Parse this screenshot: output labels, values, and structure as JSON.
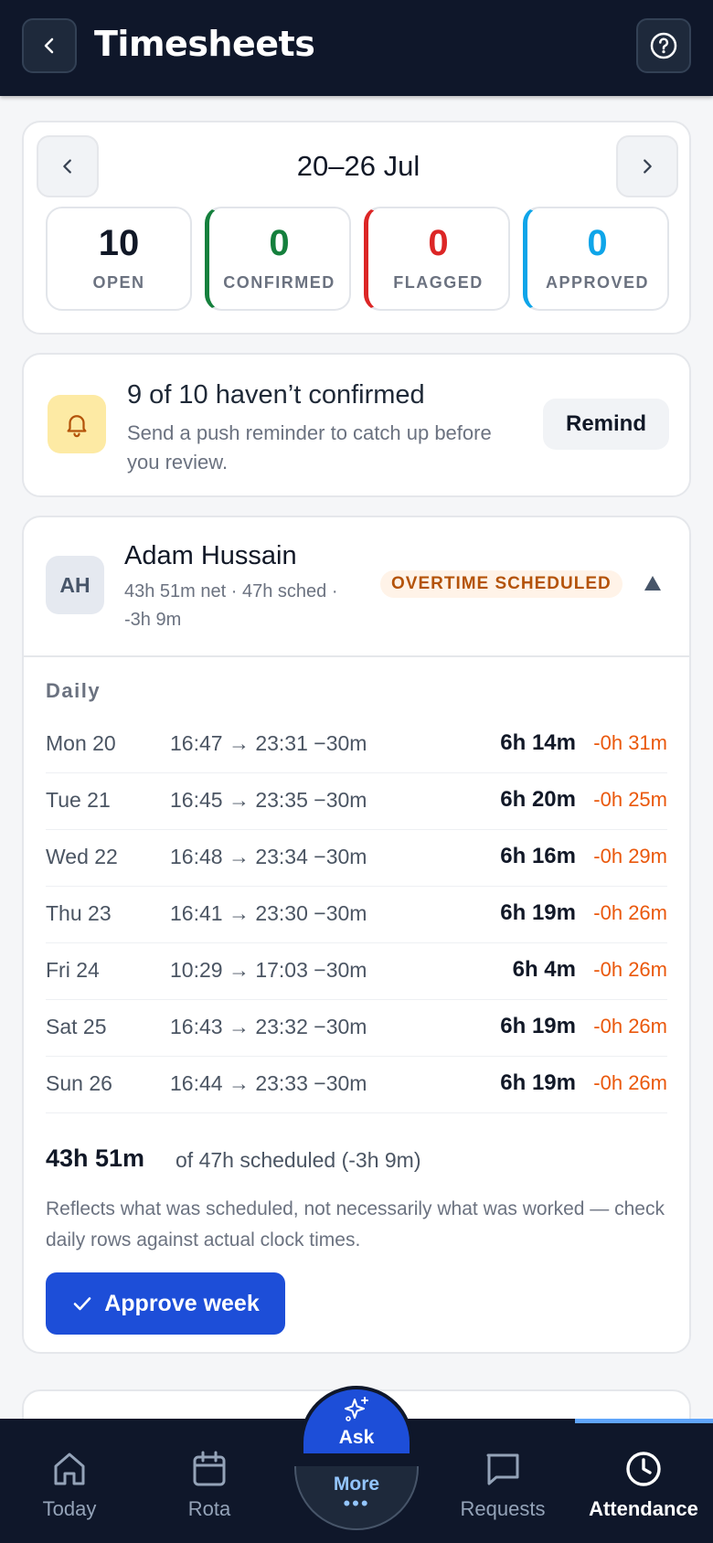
{
  "header": {
    "title": "Timesheets"
  },
  "week": {
    "label": "20–26 Jul",
    "stats": [
      {
        "value": "10",
        "label": "OPEN"
      },
      {
        "value": "0",
        "label": "CONFIRMED"
      },
      {
        "value": "0",
        "label": "FLAGGED"
      },
      {
        "value": "0",
        "label": "APPROVED"
      }
    ]
  },
  "reminder": {
    "title": "9 of 10 haven’t confirmed",
    "subtitle": "Send a push reminder to catch up before you review.",
    "button": "Remind"
  },
  "employee": {
    "initials": "AH",
    "name": "Adam Hussain",
    "summary": "43h 51m net · 47h sched · -3h 9m",
    "badge": "OVERTIME SCHEDULED",
    "daily_label": "Daily",
    "days": [
      {
        "day": "Mon 20",
        "times": "16:47 → 23:31 −30m",
        "hours": "6h 14m",
        "variance": "-0h 31m"
      },
      {
        "day": "Tue 21",
        "times": "16:45 → 23:35 −30m",
        "hours": "6h 20m",
        "variance": "-0h 25m"
      },
      {
        "day": "Wed 22",
        "times": "16:48 → 23:34 −30m",
        "hours": "6h 16m",
        "variance": "-0h 29m"
      },
      {
        "day": "Thu 23",
        "times": "16:41 → 23:30 −30m",
        "hours": "6h 19m",
        "variance": "-0h 26m"
      },
      {
        "day": "Fri 24",
        "times": "10:29 → 17:03 −30m",
        "hours": "6h 4m",
        "variance": "-0h 26m"
      },
      {
        "day": "Sat 25",
        "times": "16:43 → 23:32 −30m",
        "hours": "6h 19m",
        "variance": "-0h 26m"
      },
      {
        "day": "Sun 26",
        "times": "16:44 → 23:33 −30m",
        "hours": "6h 19m",
        "variance": "-0h 26m"
      }
    ],
    "total": "43h 51m",
    "total_of": "of 47h scheduled (-3h 9m)",
    "note": "Reflects what was scheduled, not necessarily what was worked — check daily rows against actual clock times.",
    "approve_button": "Approve week"
  },
  "bottom_nav": {
    "items": [
      {
        "label": "Today",
        "icon": "home-icon"
      },
      {
        "label": "Rota",
        "icon": "calendar-icon"
      },
      {
        "label": "Requests",
        "icon": "chat-icon"
      },
      {
        "label": "Attendance",
        "icon": "clock-icon"
      }
    ],
    "active": "Attendance",
    "ask_label": "Ask",
    "more_label": "More"
  },
  "colors": {
    "header_bg": "#0f172a",
    "accent": "#1d4ed8",
    "confirmed": "#15803d",
    "flagged": "#dc2626",
    "approved": "#0ea5e9",
    "variance": "#ea580c"
  }
}
